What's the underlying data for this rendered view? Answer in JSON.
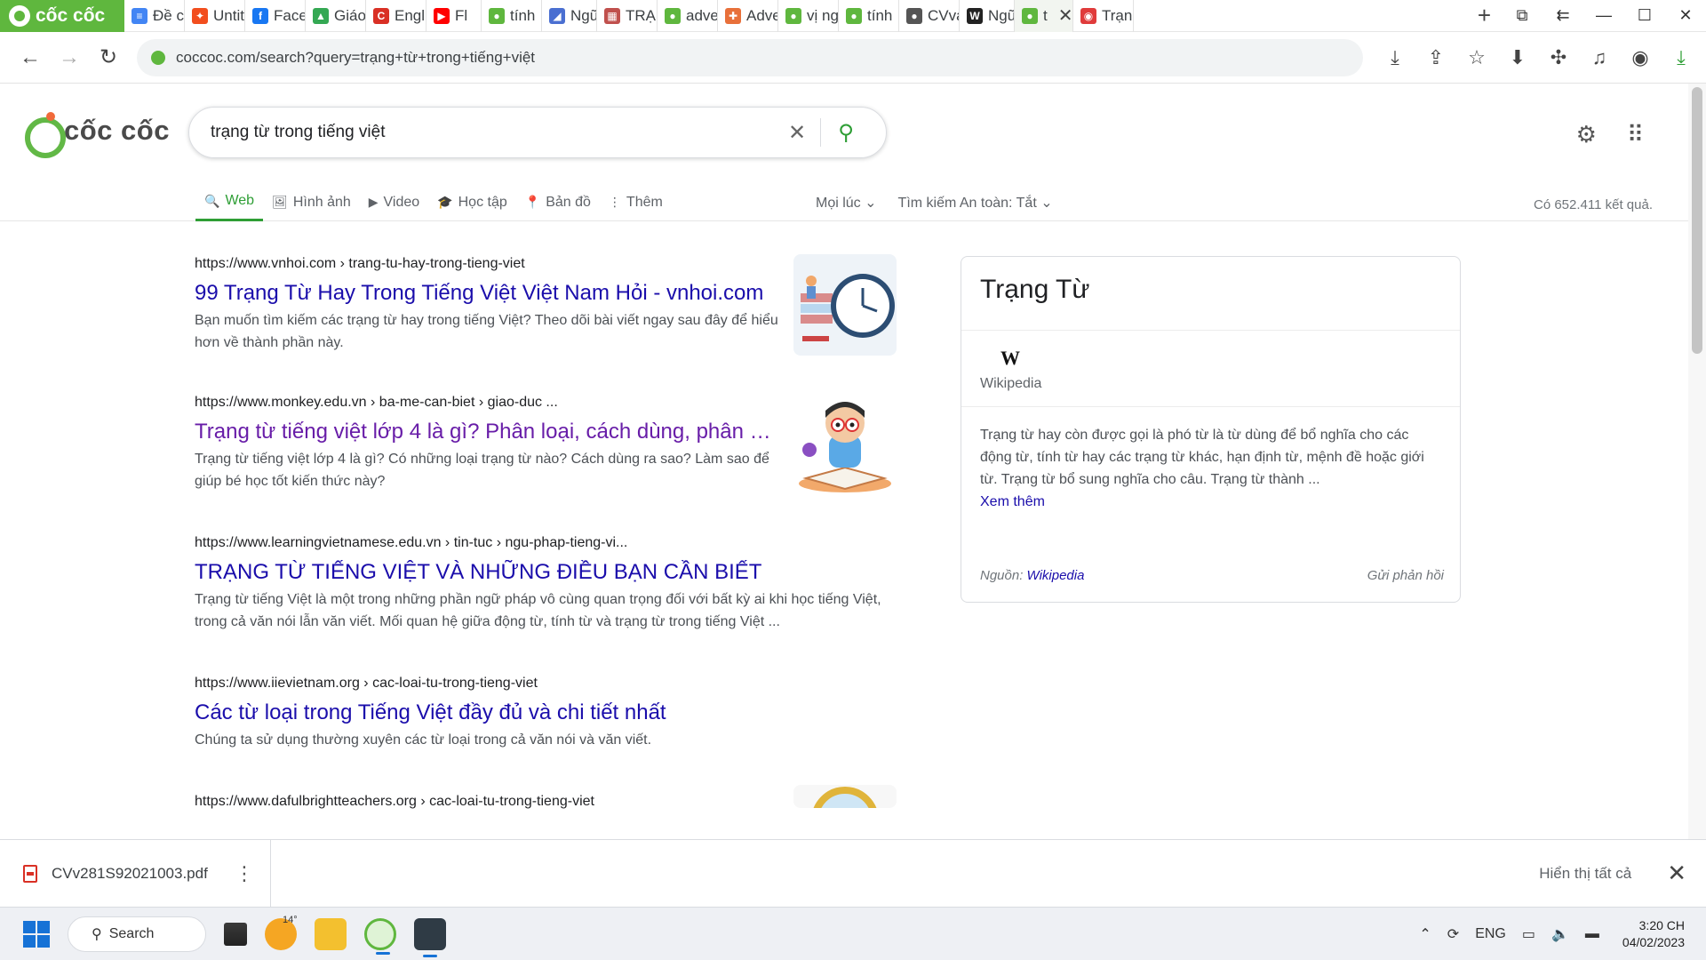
{
  "browser": {
    "brand": "cốc cốc",
    "tabs": [
      {
        "label": "Đề c",
        "color": "#4285f4",
        "glyph": "≡"
      },
      {
        "label": "Untit",
        "color": "#f24e1e",
        "glyph": "✦"
      },
      {
        "label": "Face",
        "color": "#1877f2",
        "glyph": "f"
      },
      {
        "label": "Giáo",
        "color": "#34a853",
        "glyph": "▲"
      },
      {
        "label": "Engl",
        "color": "#d93025",
        "glyph": "C"
      },
      {
        "label": "Fl",
        "color": "#ff0000",
        "glyph": "▶"
      },
      {
        "label": "tính",
        "color": "#5fb73e",
        "glyph": "●"
      },
      {
        "label": "Ngữ",
        "color": "#4a6fd1",
        "glyph": "◢"
      },
      {
        "label": "TRẠI",
        "color": "#c0504d",
        "glyph": "▦"
      },
      {
        "label": "adve",
        "color": "#5fb73e",
        "glyph": "●"
      },
      {
        "label": "Adve",
        "color": "#e8703a",
        "glyph": "✚"
      },
      {
        "label": "vị ng",
        "color": "#5fb73e",
        "glyph": "●"
      },
      {
        "label": "tính",
        "color": "#5fb73e",
        "glyph": "●"
      },
      {
        "label": "CVvả",
        "color": "#555555",
        "glyph": "●"
      },
      {
        "label": "Ngữ",
        "color": "#222222",
        "glyph": "W"
      },
      {
        "label": "t",
        "color": "#5fb73e",
        "glyph": "●",
        "active": true
      },
      {
        "label": "Trạng",
        "color": "#e03b3b",
        "glyph": "◉"
      }
    ],
    "new_tab": "+",
    "url": "coccoc.com/search?query=trạng+từ+trong+tiếng+việt"
  },
  "search": {
    "logo_text": "cốc cốc",
    "query": "trạng từ trong tiếng việt",
    "filters": [
      {
        "label": "Web",
        "icon": "🔍",
        "active": true
      },
      {
        "label": "Hình ảnh",
        "icon": "🖼"
      },
      {
        "label": "Video",
        "icon": "▶"
      },
      {
        "label": "Học tập",
        "icon": "🎓"
      },
      {
        "label": "Bản đồ",
        "icon": "📍"
      },
      {
        "label": "Thêm",
        "icon": "⋮"
      }
    ],
    "time_filter": "Mọi lúc",
    "safe_search": "Tìm kiếm An toàn: Tắt",
    "result_count": "Có 652.411 kết quả."
  },
  "results": [
    {
      "url": "https://www.vnhoi.com › trang-tu-hay-trong-tieng-viet",
      "title": "99 Trạng Từ Hay Trong Tiếng Việt Việt Nam Hỏi - vnhoi.com",
      "snippet": "Bạn muốn tìm kiếm các trạng từ hay trong tiếng Việt? Theo dõi bài viết ngay sau đây để hiểu hơn về thành phần này.",
      "visited": false,
      "thumb": "clock-illustration"
    },
    {
      "url": "https://www.monkey.edu.vn › ba-me-can-biet › giao-duc ...",
      "title": "Trạng từ tiếng việt lớp 4 là gì? Phân loại, cách dùng, phân biệt",
      "snippet": "Trạng từ tiếng việt lớp 4 là gì? Có những loại trạng từ nào? Cách dùng ra sao? Làm sao để giúp bé học tốt kiến thức này?",
      "visited": true,
      "thumb": "boy-reading-illustration"
    },
    {
      "url": "https://www.learningvietnamese.edu.vn › tin-tuc › ngu-phap-tieng-vi...",
      "title": "TRẠNG TỪ TIẾNG VIỆT VÀ NHỮNG ĐIỀU BẠN CẦN BIẾT",
      "snippet": "Trạng từ tiếng Việt là một trong những phần ngữ pháp vô cùng quan trọng đối với bất kỳ ai khi học tiếng Việt, trong cả văn nói lẫn văn viết. Mối quan hệ giữa động từ, tính từ và trạng từ trong tiếng Việt ...",
      "visited": false,
      "thumb": null
    },
    {
      "url": "https://www.iievietnam.org › cac-loai-tu-trong-tieng-viet",
      "title": "Các từ loại trong Tiếng Việt đầy đủ và chi tiết nhất",
      "snippet": "Chúng ta sử dụng thường xuyên các từ loại trong cả văn nói và văn viết.",
      "visited": false,
      "thumb": null
    },
    {
      "url": "https://www.dafulbrightteachers.org › cac-loai-tu-trong-tieng-viet",
      "title": "",
      "snippet": "",
      "visited": false,
      "thumb": "magnifier-illustration"
    }
  ],
  "knowledge_panel": {
    "title": "Trạng Từ",
    "wiki_logo": "W",
    "wiki_label": "Wikipedia",
    "description": "Trạng từ hay còn được gọi là phó từ là từ dùng để bổ nghĩa cho các động từ, tính từ hay các trạng từ khác, hạn định từ, mệnh đề hoặc giới từ. Trạng từ bổ sung nghĩa cho câu. Trạng từ thành ...",
    "more": "Xem thêm",
    "source_prefix": "Nguồn:",
    "source_link": "Wikipedia",
    "feedback": "Gửi phản hồi"
  },
  "downloads": {
    "file": "CVv281S92021003.pdf",
    "show_all": "Hiển thị tất cả"
  },
  "taskbar": {
    "search_label": "Search",
    "weather": "14°",
    "language": "ENG",
    "time": "3:20 CH",
    "date": "04/02/2023"
  }
}
